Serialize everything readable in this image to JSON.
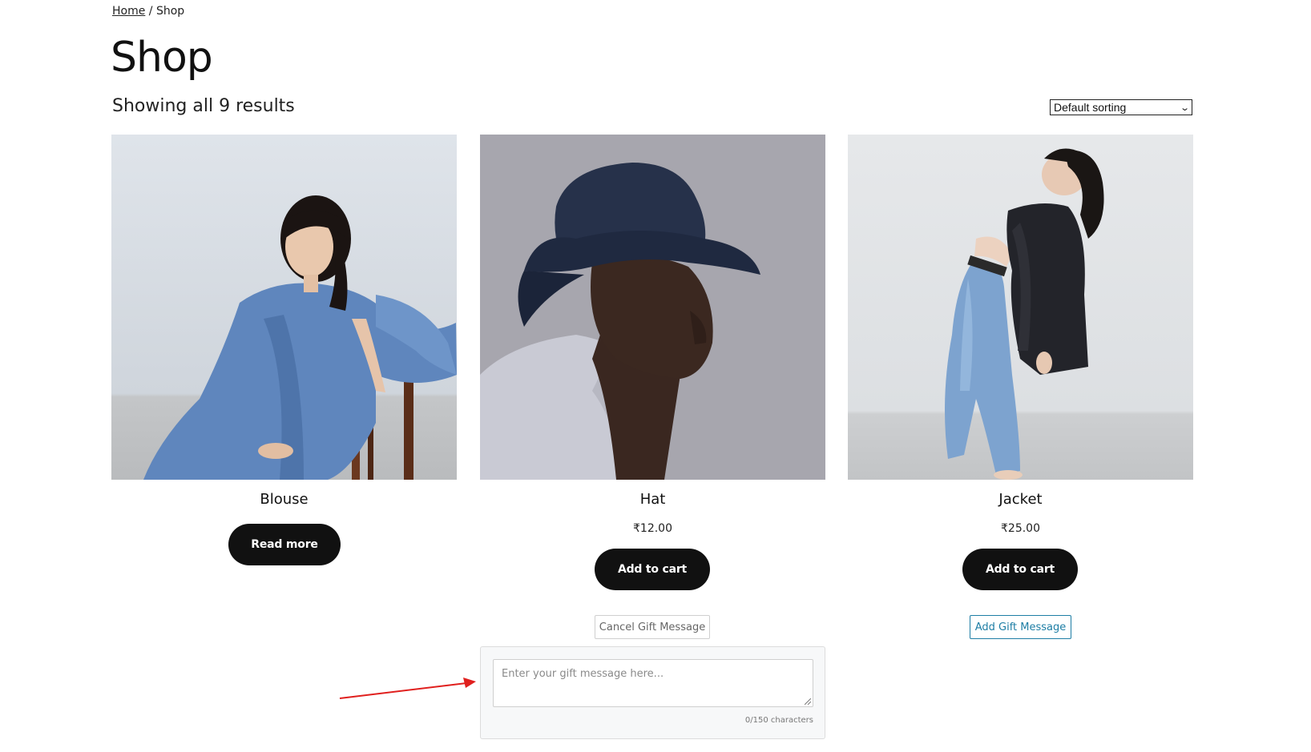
{
  "breadcrumb": {
    "home": "Home",
    "separator": "/",
    "current": "Shop"
  },
  "page": {
    "title": "Shop",
    "result_count": "Showing all 9 results"
  },
  "sorting": {
    "selected": "Default sorting"
  },
  "products": [
    {
      "name": "Blouse",
      "price": "",
      "button": "Read more",
      "image": "woman-blue-blouse-photo"
    },
    {
      "name": "Hat",
      "price": "₹12.00",
      "button": "Add to cart",
      "image": "man-navy-bucket-hat-photo"
    },
    {
      "name": "Jacket",
      "price": "₹25.00",
      "button": "Add to cart",
      "image": "woman-black-jacket-photo"
    }
  ],
  "gift": {
    "cancel_label": "Cancel Gift Message",
    "add_label": "Add Gift Message",
    "placeholder": "Enter your gift message here...",
    "char_count": "0/150 characters"
  },
  "colors": {
    "button_bg": "#111111",
    "gift_add_accent": "#1e7ea5",
    "annotation_arrow": "#e0201e"
  }
}
